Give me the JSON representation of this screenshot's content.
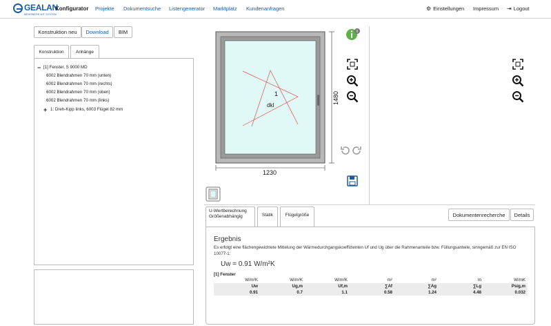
{
  "header": {
    "logo_text": "GEALAN",
    "logo_sub": "MEHRWERK MIT SYSTEM",
    "brand": "Konfigurator",
    "nav": [
      {
        "label": "Projekte"
      },
      {
        "label": "Dokumentsuche"
      },
      {
        "label": "Listengenerator"
      },
      {
        "label": "Marktplatz"
      },
      {
        "label": "Kundenanfragen"
      }
    ],
    "settings_label": "Einstellungen",
    "impressum_label": "Impressum",
    "logout_label": "Logout"
  },
  "toolbar": {
    "new_label": "Konstruktion neu",
    "download_label": "Download",
    "bim_label": "BIM"
  },
  "left_tabs": [
    {
      "label": "Konstruktion"
    },
    {
      "label": "Anhänge"
    }
  ],
  "tree": {
    "root": "[1] Fenster, S 9000 MD",
    "items": [
      "6002 Blendrahmen 70 mm (unten)",
      "6002 Blendrahmen 70 mm (rechts)",
      "6002 Blendrahmen 70 mm (oben)",
      "6002 Blendrahmen 70 mm (links)"
    ],
    "sub": "1: Dreh-Kipp links, 6003 Flügel 82 mm"
  },
  "drawing": {
    "width_label": "1230",
    "height_label": "1480",
    "sash_number": "1",
    "sash_code": "dkl",
    "info_badge": "0"
  },
  "bottom_tabs": [
    {
      "label": "U-Wertberechnung Größenabhängig"
    },
    {
      "label": "Statik"
    },
    {
      "label": "Flügelgröße"
    }
  ],
  "bottom_buttons": {
    "docs_label": "Dokumentenrecherche",
    "details_label": "Details"
  },
  "result": {
    "title": "Ergebnis",
    "text": "Es erfolgt eine flächengewichtete Mittelung der Wärmedurchgangskoeffizienten Uf und Ug über die Rahmenanteile bzw. Füllungsanteile, sinngemäß zur EN ISO 10077-1:",
    "uw": "Uw = 0.91 W/m²K",
    "section": "[1] Fenster",
    "units": [
      "W/m²K",
      "W/m²K",
      "W/m²K",
      "m²",
      "m²",
      "m",
      "W/mK"
    ],
    "headers": [
      "Uw",
      "Ug,m",
      "Uf,m",
      "∑Af",
      "∑Ag",
      "∑Lg",
      "Psig,m"
    ],
    "values": [
      "0.91",
      "0.7",
      "1.1",
      "0.58",
      "1.24",
      "4.48",
      "0.032"
    ]
  }
}
